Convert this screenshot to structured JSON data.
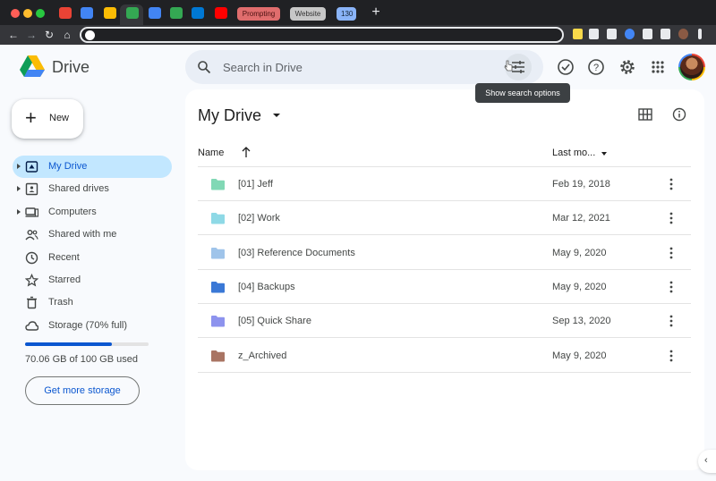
{
  "browser": {
    "tabs": [
      {
        "name": "gmail",
        "color": "#ea4335"
      },
      {
        "name": "calendar",
        "color": "#4285f4"
      },
      {
        "name": "keep",
        "color": "#fbbc04"
      },
      {
        "name": "drive",
        "color": "#34a853"
      },
      {
        "name": "docs",
        "color": "#4285f4"
      },
      {
        "name": "sheets",
        "color": "#34a853"
      },
      {
        "name": "outlook",
        "color": "#0078d4"
      },
      {
        "name": "youtube",
        "color": "#ff0000"
      }
    ],
    "tab_groups": {
      "prompting": "Prompting",
      "website": "Website",
      "count": "130"
    },
    "new_tab": "+"
  },
  "drive": {
    "brand": "Drive",
    "search_placeholder": "Search in Drive",
    "tooltip": "Show search options",
    "new_label": "New",
    "nav": [
      {
        "label": "My Drive",
        "icon": "my-drive-icon",
        "active": true,
        "expandable": true
      },
      {
        "label": "Shared drives",
        "icon": "shared-drives-icon",
        "active": false,
        "expandable": true
      },
      {
        "label": "Computers",
        "icon": "computers-icon",
        "active": false,
        "expandable": true
      },
      {
        "label": "Shared with me",
        "icon": "shared-with-me-icon",
        "active": false,
        "expandable": false
      },
      {
        "label": "Recent",
        "icon": "clock-icon",
        "active": false,
        "expandable": false
      },
      {
        "label": "Starred",
        "icon": "star-icon",
        "active": false,
        "expandable": false
      },
      {
        "label": "Trash",
        "icon": "trash-icon",
        "active": false,
        "expandable": false
      },
      {
        "label": "Storage (70% full)",
        "icon": "cloud-icon",
        "active": false,
        "expandable": false
      }
    ],
    "storage": {
      "used_fraction": 0.7006,
      "text": "70.06 GB of 100 GB used",
      "button": "Get more storage"
    },
    "main_title": "My Drive",
    "columns": {
      "name": "Name",
      "modified": "Last mo..."
    },
    "files": [
      {
        "name": "[01] Jeff",
        "date": "Feb 19, 2018",
        "color": "#81d8b5"
      },
      {
        "name": "[02] Work",
        "date": "Mar 12, 2021",
        "color": "#8ed9e6"
      },
      {
        "name": "[03] Reference Documents",
        "date": "May 9, 2020",
        "color": "#9fc4ea"
      },
      {
        "name": "[04] Backups",
        "date": "May 9, 2020",
        "color": "#3a78d6"
      },
      {
        "name": "[05] Quick Share",
        "date": "Sep 13, 2020",
        "color": "#8d93ee"
      },
      {
        "name": "z_Archived",
        "date": "May 9, 2020",
        "color": "#a97463"
      }
    ]
  }
}
